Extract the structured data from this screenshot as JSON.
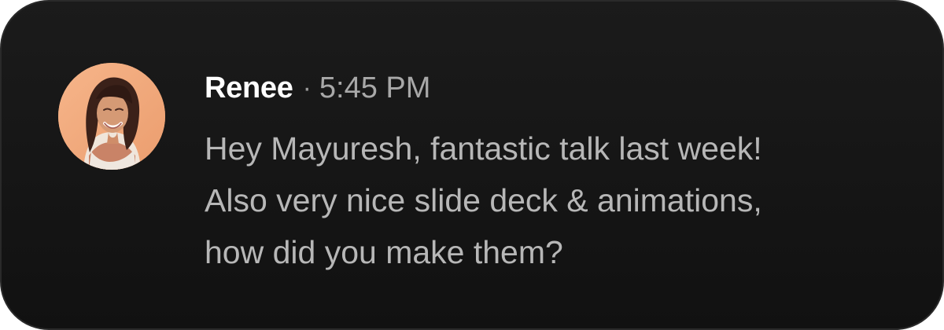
{
  "message": {
    "sender": "Renee",
    "separator": "·",
    "time": "5:45 PM",
    "lines": [
      "Hey Mayuresh, fantastic talk last week!",
      "Also very nice slide deck & animations,",
      "how did you make them?"
    ],
    "avatar": {
      "icon": "user-avatar-photo",
      "background_color": "#f3a97a"
    }
  },
  "colors": {
    "card_background": "#151515",
    "sender_text": "#ffffff",
    "secondary_text": "#a8a8a8",
    "message_text": "#b7b7b7"
  }
}
